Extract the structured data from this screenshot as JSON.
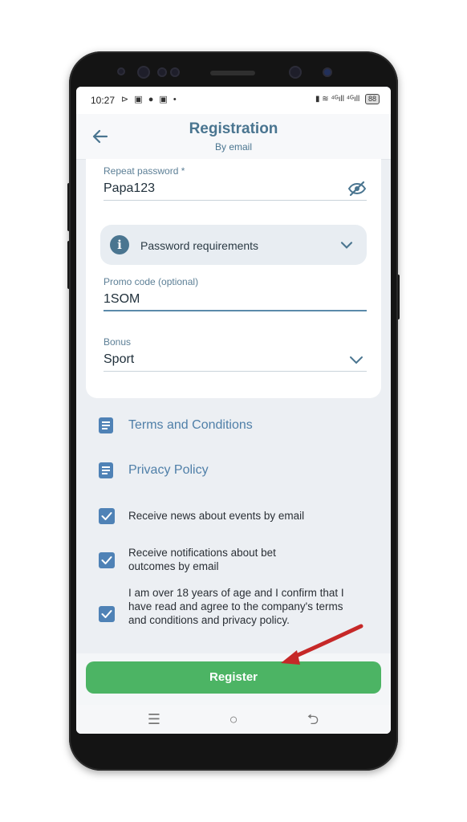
{
  "status_bar": {
    "time": "10:27",
    "left_icons": "⊳ ▣ ● ▣ •",
    "right_icons": "▮ ≋ ⁴ᴳıll ⁴ᴳıll",
    "battery": "88"
  },
  "header": {
    "back_icon": "arrow-left-icon",
    "title": "Registration",
    "subtitle": "By email"
  },
  "form": {
    "repeat_password": {
      "label": "Repeat password *",
      "value": "Papa123",
      "toggle_icon": "eye-slash-icon"
    },
    "password_requirements": {
      "label": "Password requirements",
      "icon": "info-icon"
    },
    "promo_code": {
      "label": "Promo code (optional)",
      "value": "1SOM"
    },
    "bonus": {
      "label": "Bonus",
      "value": "Sport"
    }
  },
  "links": [
    {
      "label": "Terms and Conditions",
      "icon": "document-icon"
    },
    {
      "label": "Privacy Policy",
      "icon": "document-icon"
    }
  ],
  "checkboxes": [
    {
      "label": "Receive news about events by email",
      "checked": true
    },
    {
      "label": "Receive notifications about bet outcomes by email",
      "checked": true
    },
    {
      "label": "I am over 18 years of age and I confirm that I have read and agree to the company's terms and conditions and privacy policy.",
      "checked": true
    }
  ],
  "register_button": {
    "label": "Register"
  },
  "nav_bar": {
    "recents": "☰",
    "home": "○",
    "back": "⮌"
  },
  "colors": {
    "accent": "#4a7590",
    "checkbox": "#4f82b6",
    "register_button": "#4cb464",
    "annotation_arrow": "#c62828"
  }
}
